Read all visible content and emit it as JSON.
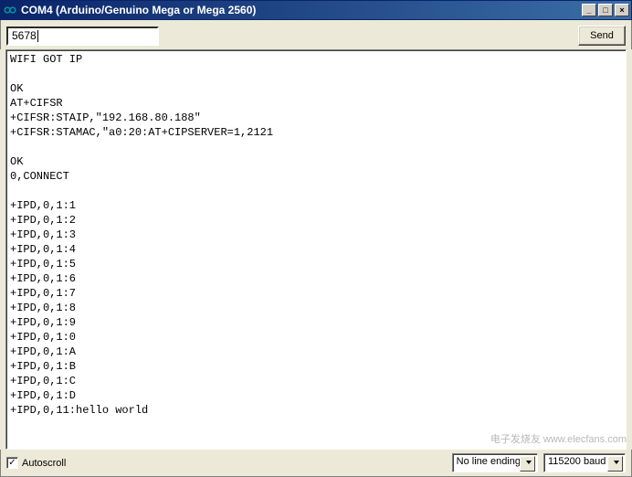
{
  "window": {
    "title": "COM4 (Arduino/Genuino Mega or Mega 2560)"
  },
  "input": {
    "value": "5678",
    "send_label": "Send"
  },
  "console_lines": [
    "WIFI GOT IP",
    "",
    "OK",
    "AT+CIFSR",
    "+CIFSR:STAIP,\"192.168.80.188\"",
    "+CIFSR:STAMAC,\"a0:20:AT+CIPSERVER=1,2121",
    "",
    "OK",
    "0,CONNECT",
    "",
    "+IPD,0,1:1",
    "+IPD,0,1:2",
    "+IPD,0,1:3",
    "+IPD,0,1:4",
    "+IPD,0,1:5",
    "+IPD,0,1:6",
    "+IPD,0,1:7",
    "+IPD,0,1:8",
    "+IPD,0,1:9",
    "+IPD,0,1:0",
    "+IPD,0,1:A",
    "+IPD,0,1:B",
    "+IPD,0,1:C",
    "+IPD,0,1:D",
    "+IPD,0,11:hello world"
  ],
  "footer": {
    "autoscroll_label": "Autoscroll",
    "autoscroll_checked": true,
    "lineending_selected": "No line ending",
    "baud_selected": "115200 baud"
  },
  "watermark": "电子发烧友 www.elecfans.com"
}
